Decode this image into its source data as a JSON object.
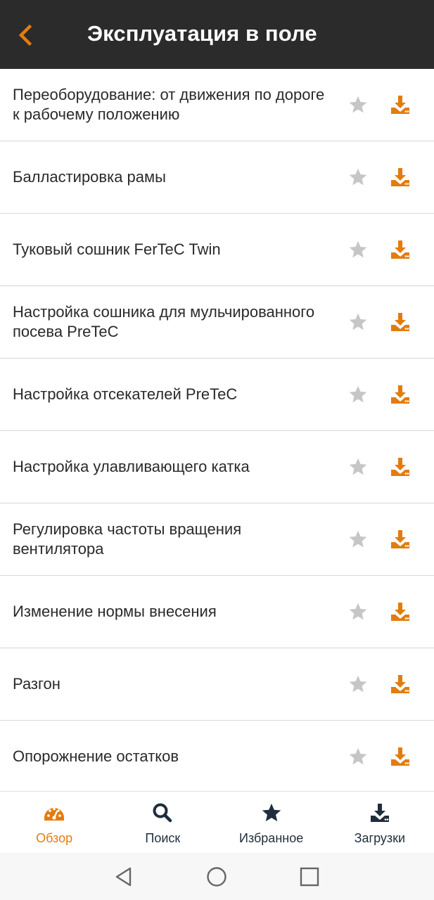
{
  "header": {
    "title": "Эксплуатация в поле",
    "back_icon": "chevron-left-icon"
  },
  "colors": {
    "header_bg": "#2b2b2b",
    "accent": "#e37c0f",
    "star_inactive": "#c6c6c6",
    "nav_dark": "#1f2d3d"
  },
  "items": [
    {
      "label": "Переоборудование: от движения по дороге к рабочему положению"
    },
    {
      "label": "Балластировка рамы"
    },
    {
      "label": "Туковый сошник FerTeC Twin"
    },
    {
      "label": "Настройка сошника для мульчированного посева PreTeC"
    },
    {
      "label": "Настройка отсекателей PreTeC"
    },
    {
      "label": "Настройка улавливающего катка"
    },
    {
      "label": "Регулировка частоты вращения вентилятора"
    },
    {
      "label": "Изменение нормы внесения"
    },
    {
      "label": "Разгон"
    },
    {
      "label": "Опорожнение остатков"
    }
  ],
  "bottom_nav": [
    {
      "label": "Обзор",
      "icon": "speedometer-icon",
      "active": true
    },
    {
      "label": "Поиск",
      "icon": "search-icon",
      "active": false
    },
    {
      "label": "Избранное",
      "icon": "star-icon",
      "active": false
    },
    {
      "label": "Загрузки",
      "icon": "download-icon",
      "active": false
    }
  ],
  "system_nav": [
    "back-triangle-icon",
    "home-circle-icon",
    "recents-square-icon"
  ]
}
